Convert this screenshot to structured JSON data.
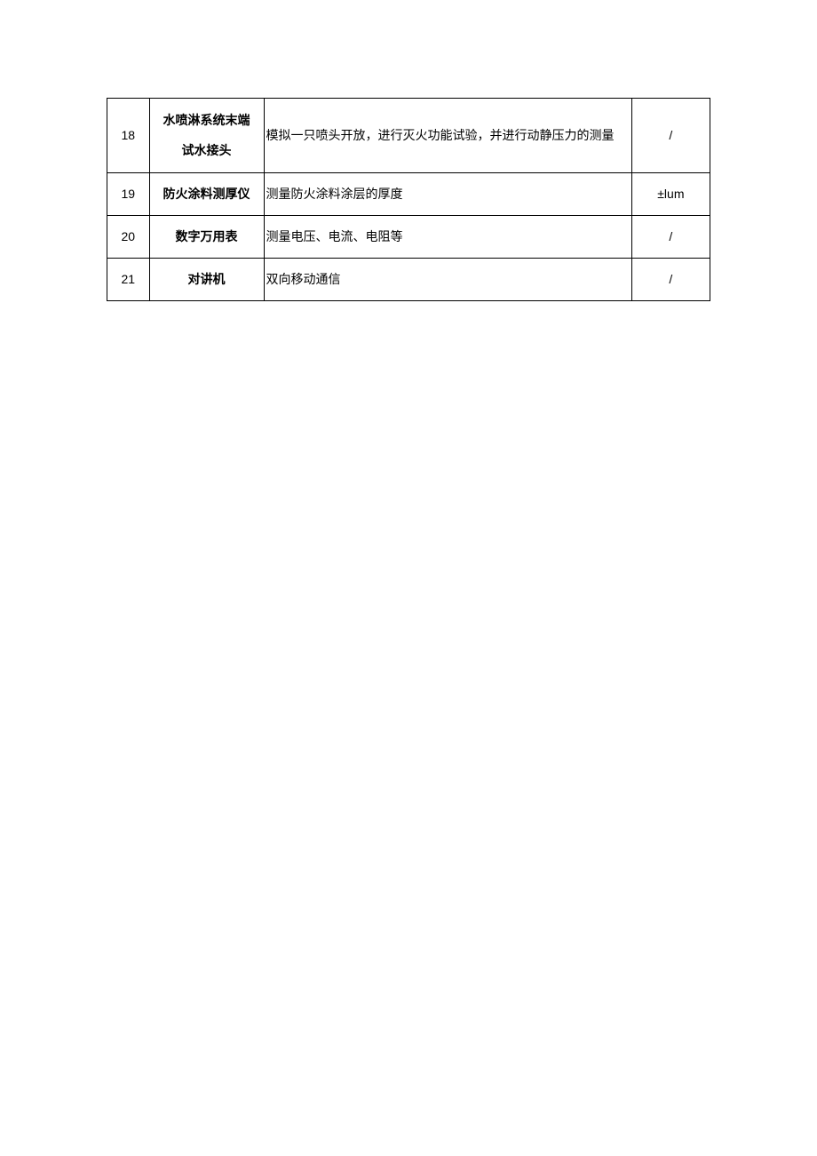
{
  "table": {
    "rows": [
      {
        "num": "18",
        "name": "水喷淋系统末端\n试水接头",
        "desc": "模拟一只喷头开放，进行灭火功能试验，并进行动静压力的测量",
        "spec": "/"
      },
      {
        "num": "19",
        "name": "防火涂料测厚仪",
        "desc": "测量防火涂料涂层的厚度",
        "spec": "±lum"
      },
      {
        "num": "20",
        "name": "数字万用表",
        "desc": "测量电压、电流、电阻等",
        "spec": "/"
      },
      {
        "num": "21",
        "name": "对讲机",
        "desc": "双向移动通信",
        "spec": "/"
      }
    ]
  }
}
